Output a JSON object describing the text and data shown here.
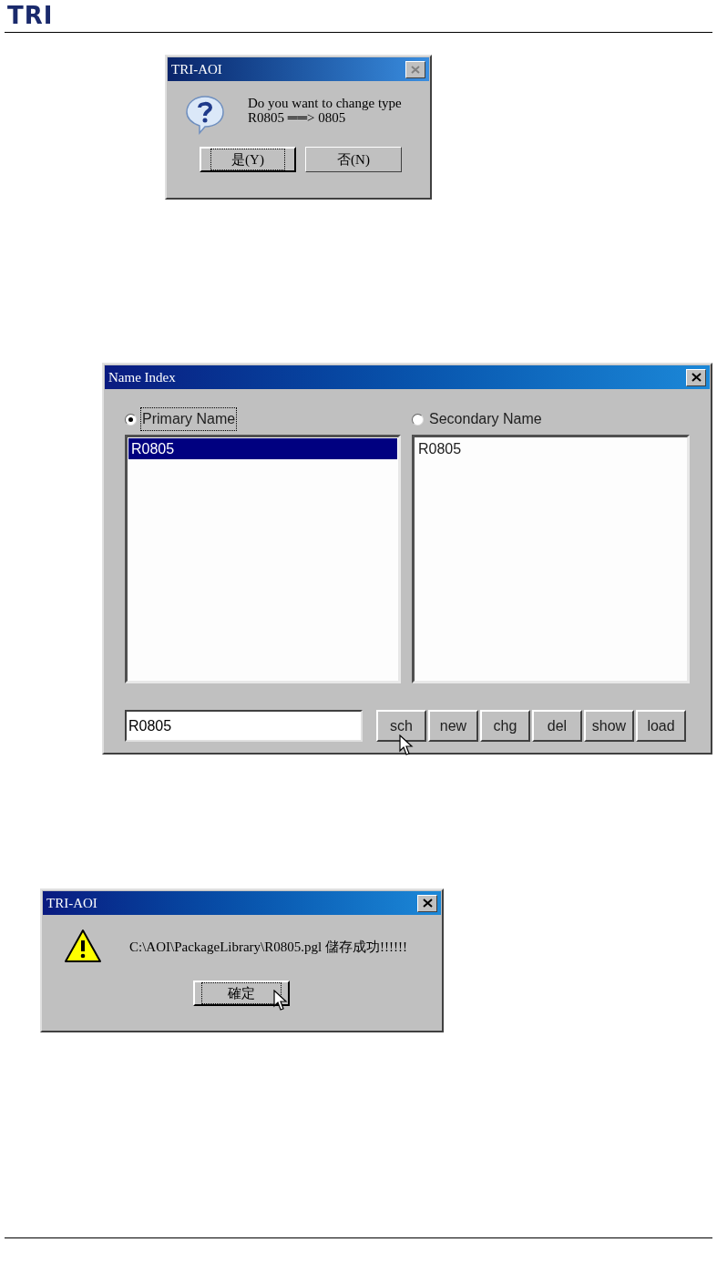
{
  "header": {
    "logo": "TRI"
  },
  "confirm_dialog": {
    "title": "TRI-AOI",
    "message_lines": [
      "Do you want to change type",
      "R0805 ══> 0805"
    ],
    "buttons": [
      {
        "label": "是(Y)",
        "focused": true
      },
      {
        "label": "否(N)",
        "focused": false
      }
    ]
  },
  "name_index_dialog": {
    "title": "Name Index",
    "radios": [
      {
        "label": "Primary Name",
        "selected": true
      },
      {
        "label": "Secondary Name",
        "selected": false
      }
    ],
    "lists": [
      {
        "items": [
          {
            "text": "R0805",
            "selected": true
          }
        ]
      },
      {
        "items": [
          {
            "text": "R0805",
            "selected": false
          }
        ]
      }
    ],
    "name_field": {
      "value": "R0805"
    },
    "buttons": [
      "sch",
      "new",
      "chg",
      "del",
      "show",
      "load"
    ]
  },
  "info_dialog": {
    "title": "TRI-AOI",
    "message": "C:\\AOI\\PackageLibrary\\R0805.pgl 儲存成功!!!!!!",
    "buttons": [
      {
        "label": "確定",
        "focused": true
      }
    ]
  }
}
